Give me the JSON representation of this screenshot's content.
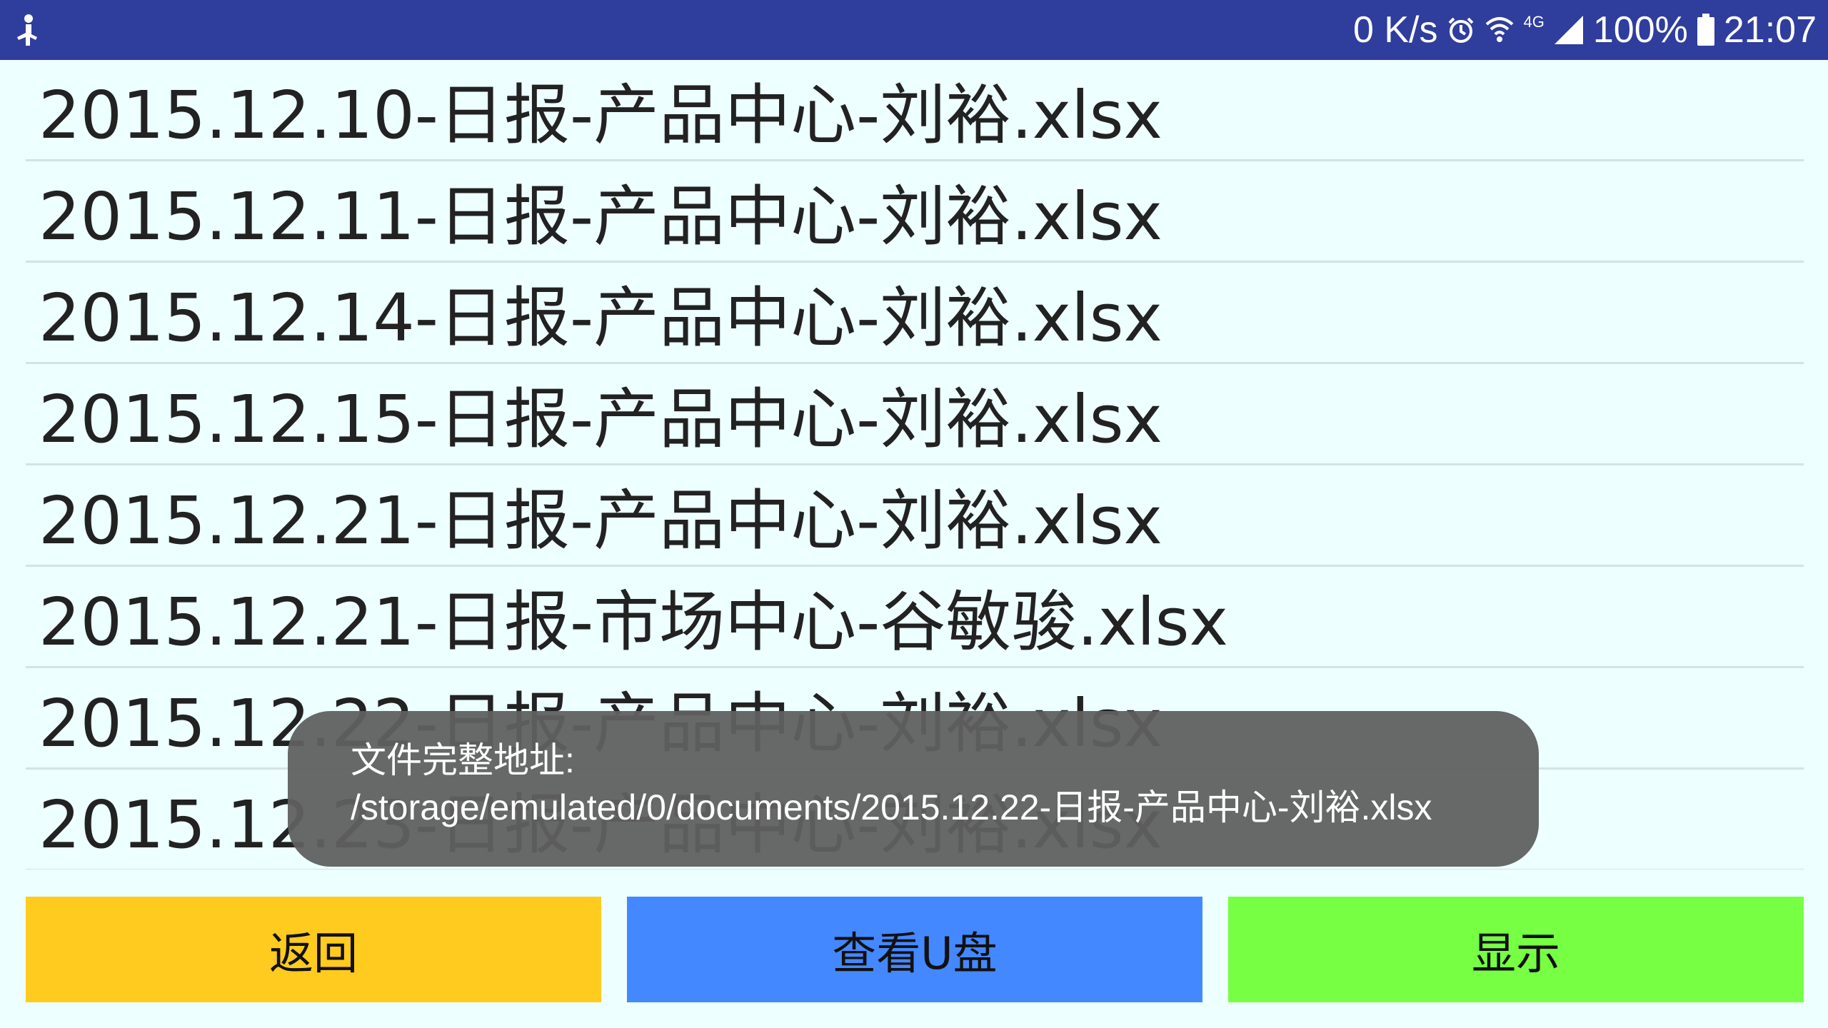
{
  "status_bar": {
    "network_speed": "0 K/s",
    "network_type": "4G",
    "battery": "100%",
    "time": "21:07",
    "icons": [
      "usb-debug-icon",
      "alarm-icon",
      "wifi-icon",
      "signal-icon",
      "battery-icon"
    ],
    "background_color": "#2F3D9C"
  },
  "files": [
    {
      "name": "2015.12.10-日报-产品中心-刘裕.xlsx"
    },
    {
      "name": "2015.12.11-日报-产品中心-刘裕.xlsx"
    },
    {
      "name": "2015.12.14-日报-产品中心-刘裕.xlsx"
    },
    {
      "name": "2015.12.15-日报-产品中心-刘裕.xlsx"
    },
    {
      "name": "2015.12.21-日报-产品中心-刘裕.xlsx"
    },
    {
      "name": "2015.12.21-日报-市场中心-谷敏骏.xlsx"
    },
    {
      "name": "2015.12.22-日报-产品中心-刘裕.xlsx"
    },
    {
      "name": "2015.12.23-日报-产品中心-刘裕.xlsx"
    }
  ],
  "toast": {
    "title": "文件完整地址:",
    "path": "/storage/emulated/0/documents/2015.12.22-日报-产品中心-刘裕.xlsx"
  },
  "buttons": {
    "back": "返回",
    "view_usb": "查看U盘",
    "show": "显示"
  },
  "colors": {
    "background": "#EDFFFF",
    "back_button": "#FFCB1F",
    "usb_button": "#4488FF",
    "show_button": "#77FF44"
  }
}
